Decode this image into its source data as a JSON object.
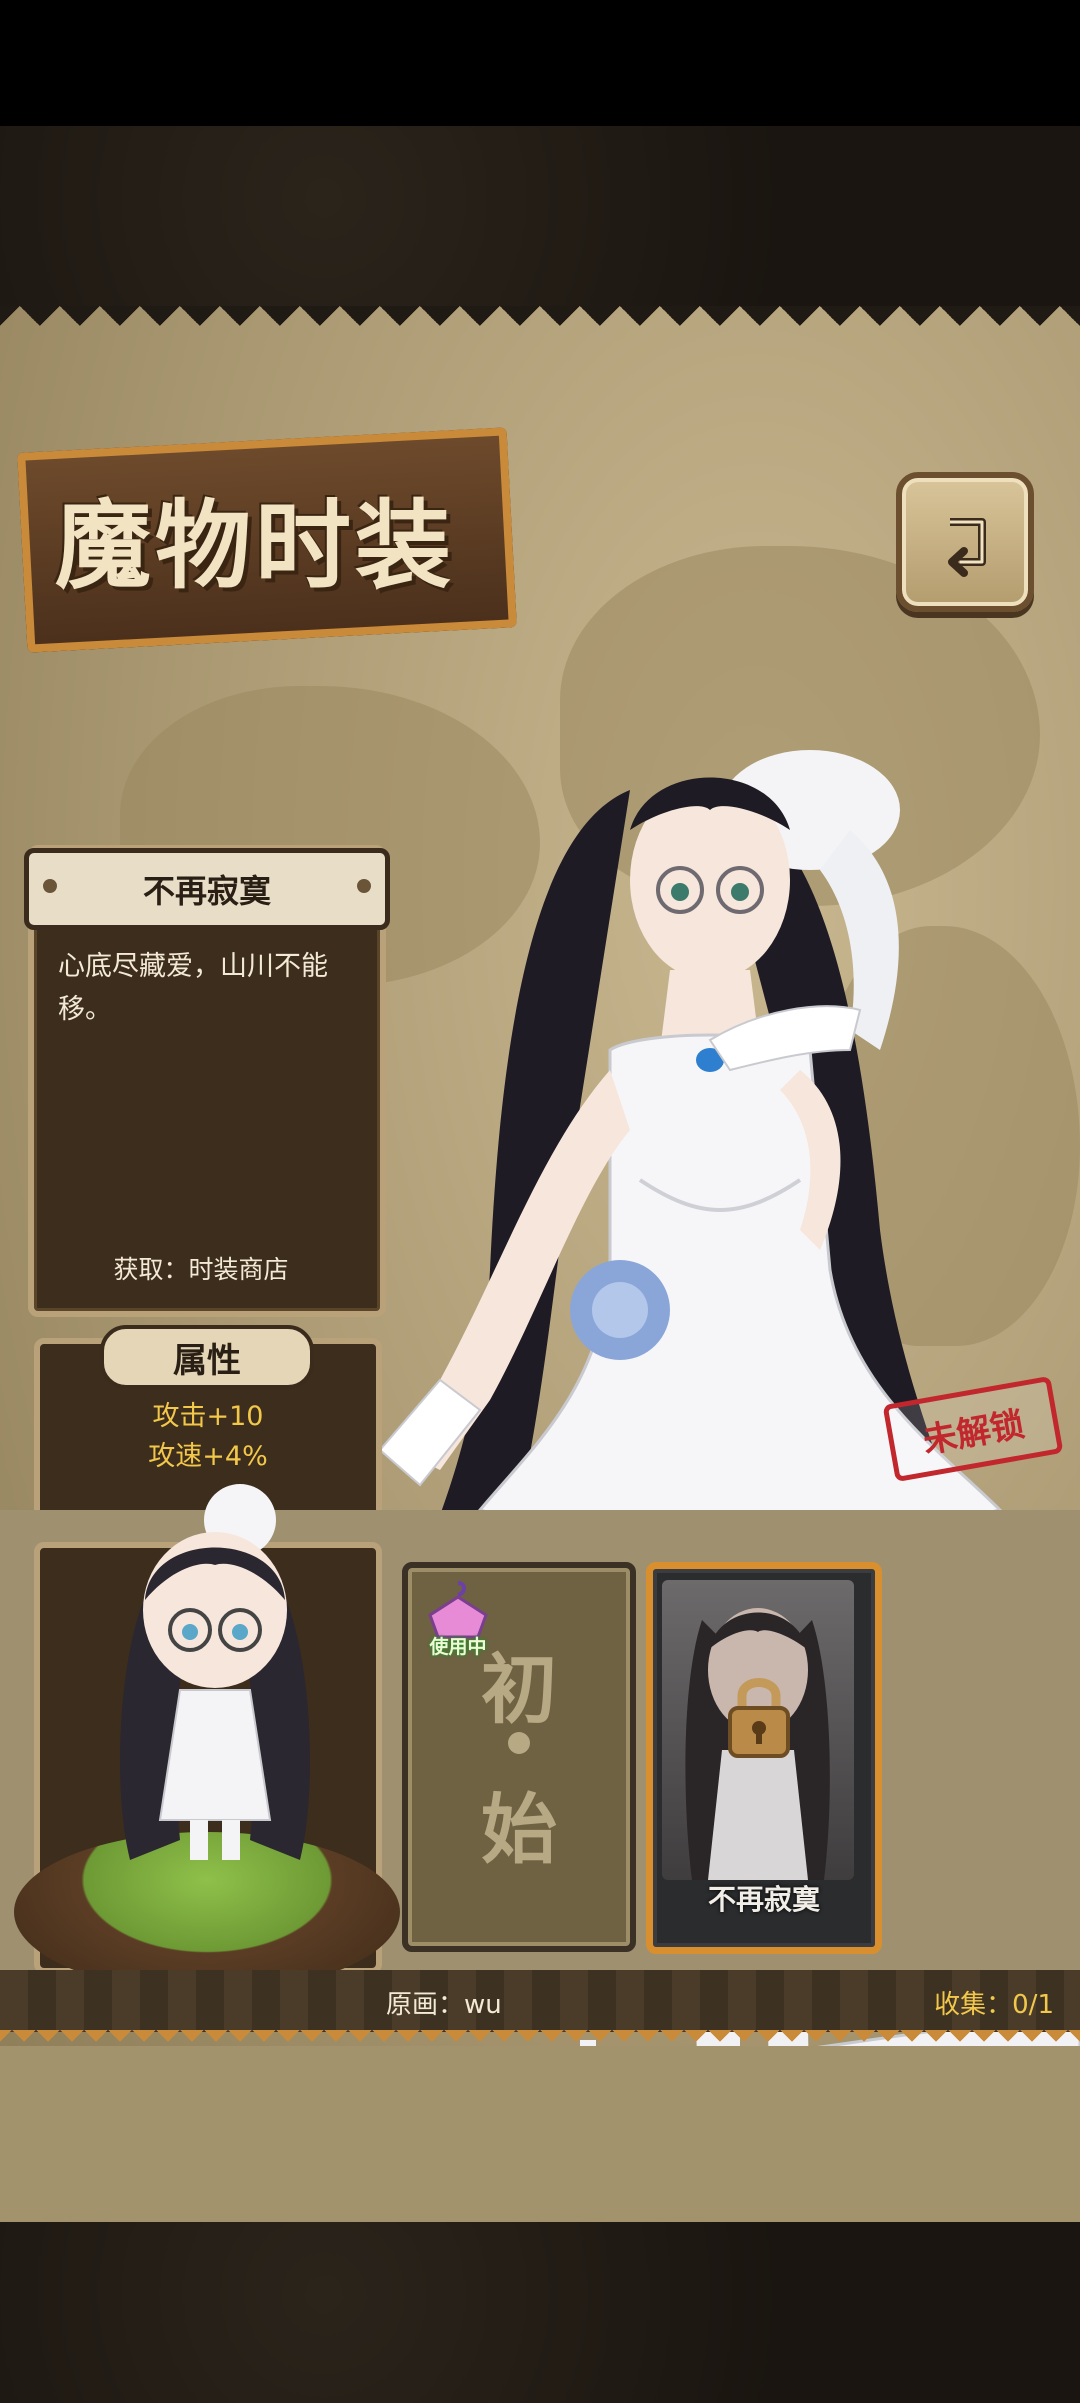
{
  "screen": {
    "title": "魔物时装"
  },
  "outfit": {
    "name": "不再寂寞",
    "description": "心底尽藏爱，山川不能移。",
    "source": "获取：时装商店",
    "stamp_text": "未解锁"
  },
  "attributes": {
    "label": "属性",
    "items": [
      "攻击+10",
      "攻速+4%"
    ]
  },
  "cards": {
    "default": {
      "char_top": "初",
      "char_bottom": "始",
      "badge": "使用中"
    },
    "locked": {
      "name": "不再寂寞"
    }
  },
  "footer": {
    "artist": "原画：wu",
    "collection": "收集：0/1"
  },
  "icons": {
    "back": "back-arrow-icon",
    "lock": "lock-icon",
    "in_use": "outfit-hanger-icon"
  },
  "colors": {
    "accent_orange": "#d98f2d",
    "attribute_yellow": "#f2c84b",
    "stamp_red": "#c1272d"
  }
}
